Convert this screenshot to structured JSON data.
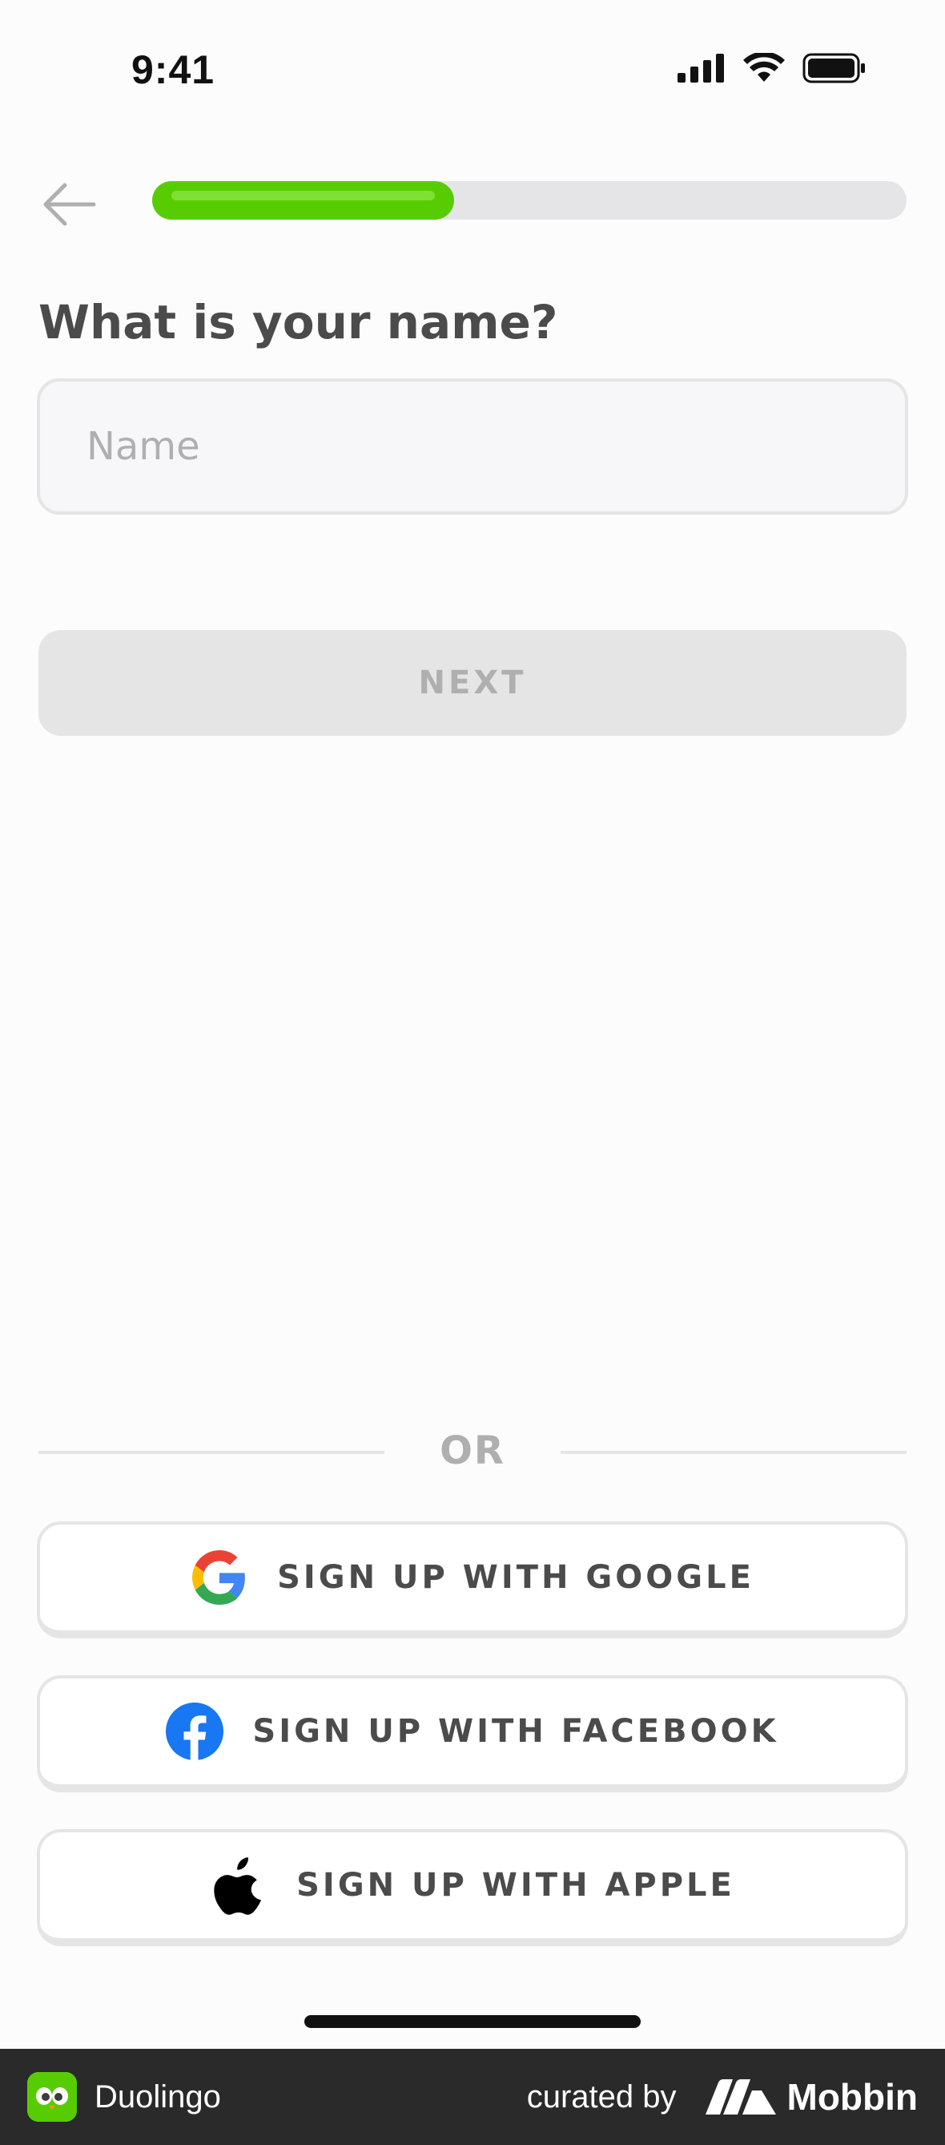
{
  "status_bar": {
    "time": "9:41"
  },
  "nav": {
    "back_icon": "arrow-left-icon",
    "progress_fraction": 0.4
  },
  "main": {
    "title": "What is your name?",
    "name_field": {
      "placeholder": "Name",
      "value": ""
    },
    "next_label": "NEXT",
    "divider_label": "OR",
    "social_buttons": [
      {
        "label": "SIGN UP WITH GOOGLE",
        "icon": "google-icon"
      },
      {
        "label": "SIGN UP WITH FACEBOOK",
        "icon": "facebook-icon"
      },
      {
        "label": "SIGN UP WITH APPLE",
        "icon": "apple-icon"
      }
    ]
  },
  "footer": {
    "app_name": "Duolingo",
    "curated_label": "curated by",
    "brand": "Mobbin"
  },
  "colors": {
    "accent": "#58cc02",
    "text": "#4b4b4b",
    "muted": "#afafaf",
    "facebook": "#1877f2"
  }
}
